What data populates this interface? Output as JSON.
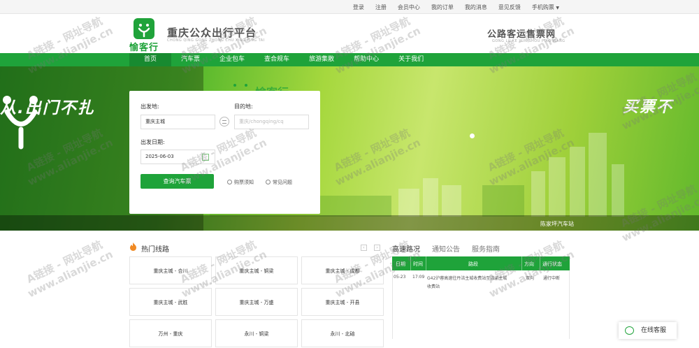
{
  "topbar": {
    "links": [
      "登录",
      "注册",
      "会员中心",
      "我的订单",
      "我的消息",
      "意见反馈",
      "手机购票"
    ]
  },
  "header": {
    "logo_text": "愉客行",
    "site_title": "重庆公众出行平台",
    "site_subtitle": "CHONG QING GONG ZHONG CHU XING PING TAI",
    "right_title": "公路客运售票网",
    "right_subtitle": "GONG LU KE YUN SHOU PIAO WANG"
  },
  "nav": {
    "items": [
      "首页",
      "汽车票",
      "企业包车",
      "查合规车",
      "旅游集散",
      "帮助中心",
      "关于我们"
    ]
  },
  "banner": {
    "slogan_left": "从.出门不扎",
    "slogan_right": "买票不",
    "brand_partial": "愉客行",
    "station": "陈家坪汽车站"
  },
  "search": {
    "from_label": "出发地:",
    "from_value": "重庆主城",
    "to_label": "目的地:",
    "to_placeholder": "重庆/chongqing/cq",
    "date_label": "出发日期:",
    "date_value": "2025-06-03",
    "button": "查询汽车票",
    "notice": "购票须知",
    "faq": "常见问题"
  },
  "hot_routes": {
    "title": "热门线路",
    "routes": [
      "重庆主城 - 合川",
      "重庆主城 - 铜梁",
      "重庆主城 - 成都",
      "重庆主城 - 武胜",
      "重庆主城 - 万盛",
      "重庆主城 - 开县",
      "万州 - 重庆",
      "永川 - 铜梁",
      "永川 - 北碚"
    ]
  },
  "info_panel": {
    "tabs": [
      "高速路况",
      "通知公告",
      "服务指南"
    ],
    "columns": [
      "日期",
      "时间",
      "路段",
      "方向",
      "通行状态"
    ],
    "rows": [
      {
        "date": "05-23",
        "time": "17:09",
        "section_line1": "G42沪蓉高速往丹涪主城收费站至涪渝主城",
        "section_line2": "收费站",
        "direction": "双向",
        "status": "通行中断"
      }
    ]
  },
  "chat": {
    "label": "在线客服"
  },
  "watermark": {
    "line1": "A链接 - 网址导航",
    "line2": "www.alianjie.cn"
  }
}
